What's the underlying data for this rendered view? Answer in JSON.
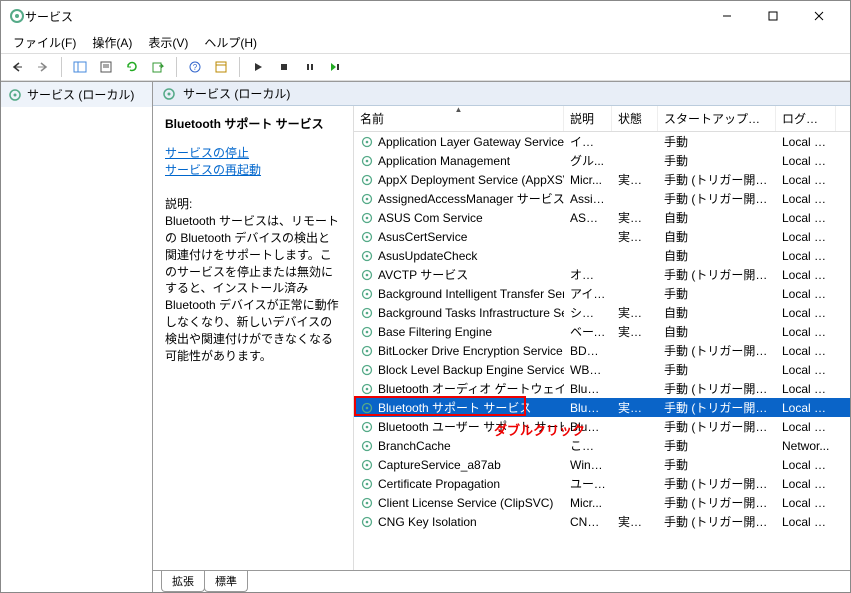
{
  "window": {
    "title": "サービス"
  },
  "menu": {
    "file": "ファイル(F)",
    "action": "操作(A)",
    "view": "表示(V)",
    "help": "ヘルプ(H)"
  },
  "tree": {
    "root": "サービス (ローカル)"
  },
  "panel": {
    "header": "サービス (ローカル)",
    "selected_name": "Bluetooth サポート サービス",
    "link_stop": "サービスの停止",
    "link_restart": "サービスの再起動",
    "desc_label": "説明:",
    "desc_text": "Bluetooth サービスは、リモートの Bluetooth デバイスの検出と関連付けをサポートします。このサービスを停止または無効にすると、インストール済み Bluetooth デバイスが正常に動作しなくなり、新しいデバイスの検出や関連付けができなくなる可能性があります。"
  },
  "columns": {
    "name": "名前",
    "desc": "説明",
    "status": "状態",
    "startup": "スタートアップの種類",
    "logon": "ログオン"
  },
  "services": [
    {
      "name": "Application Layer Gateway Service",
      "desc": "インタ...",
      "status": "",
      "startup": "手動",
      "logon": "Local S..."
    },
    {
      "name": "Application Management",
      "desc": "グル...",
      "status": "",
      "startup": "手動",
      "logon": "Local S..."
    },
    {
      "name": "AppX Deployment Service (AppXSVC)",
      "desc": "Micr...",
      "status": "実行中",
      "startup": "手動 (トリガー開始)",
      "logon": "Local S..."
    },
    {
      "name": "AssignedAccessManager サービス",
      "desc": "Assig...",
      "status": "",
      "startup": "手動 (トリガー開始)",
      "logon": "Local S..."
    },
    {
      "name": "ASUS Com Service",
      "desc": "ASUS...",
      "status": "実行中",
      "startup": "自動",
      "logon": "Local S..."
    },
    {
      "name": "AsusCertService",
      "desc": "",
      "status": "実行中",
      "startup": "自動",
      "logon": "Local S..."
    },
    {
      "name": "AsusUpdateCheck",
      "desc": "",
      "status": "",
      "startup": "自動",
      "logon": "Local S..."
    },
    {
      "name": "AVCTP サービス",
      "desc": "オーデ...",
      "status": "",
      "startup": "手動 (トリガー開始)",
      "logon": "Local S..."
    },
    {
      "name": "Background Intelligent Transfer Ser...",
      "desc": "アイド...",
      "status": "",
      "startup": "手動",
      "logon": "Local S..."
    },
    {
      "name": "Background Tasks Infrastructure Ser...",
      "desc": "システ...",
      "status": "実行中",
      "startup": "自動",
      "logon": "Local S..."
    },
    {
      "name": "Base Filtering Engine",
      "desc": "ベース...",
      "status": "実行中",
      "startup": "自動",
      "logon": "Local S..."
    },
    {
      "name": "BitLocker Drive Encryption Service",
      "desc": "BDES...",
      "status": "",
      "startup": "手動 (トリガー開始)",
      "logon": "Local S..."
    },
    {
      "name": "Block Level Backup Engine Service",
      "desc": "WBE...",
      "status": "",
      "startup": "手動",
      "logon": "Local S..."
    },
    {
      "name": "Bluetooth オーディオ ゲートウェイ サービス",
      "desc": "Bluet...",
      "status": "",
      "startup": "手動 (トリガー開始)",
      "logon": "Local S..."
    },
    {
      "name": "Bluetooth サポート サービス",
      "desc": "Bluet...",
      "status": "実行中",
      "startup": "手動 (トリガー開始)",
      "logon": "Local S...",
      "selected": true
    },
    {
      "name": "Bluetooth ユーザー サポート サービス_a8...",
      "desc": "Bluet...",
      "status": "",
      "startup": "手動 (トリガー開始)",
      "logon": "Local S..."
    },
    {
      "name": "BranchCache",
      "desc": "このサ...",
      "status": "",
      "startup": "手動",
      "logon": "Networ..."
    },
    {
      "name": "CaptureService_a87ab",
      "desc": "Wind...",
      "status": "",
      "startup": "手動",
      "logon": "Local S..."
    },
    {
      "name": "Certificate Propagation",
      "desc": "ユーザ...",
      "status": "",
      "startup": "手動 (トリガー開始)",
      "logon": "Local S..."
    },
    {
      "name": "Client License Service (ClipSVC)",
      "desc": "Micr...",
      "status": "",
      "startup": "手動 (トリガー開始)",
      "logon": "Local S..."
    },
    {
      "name": "CNG Key Isolation",
      "desc": "CNG ...",
      "status": "実行中",
      "startup": "手動 (トリガー開始)",
      "logon": "Local S..."
    }
  ],
  "tabs": {
    "extended": "拡張",
    "standard": "標準"
  },
  "annotation": "ダブルクリック",
  "chart_data": null
}
